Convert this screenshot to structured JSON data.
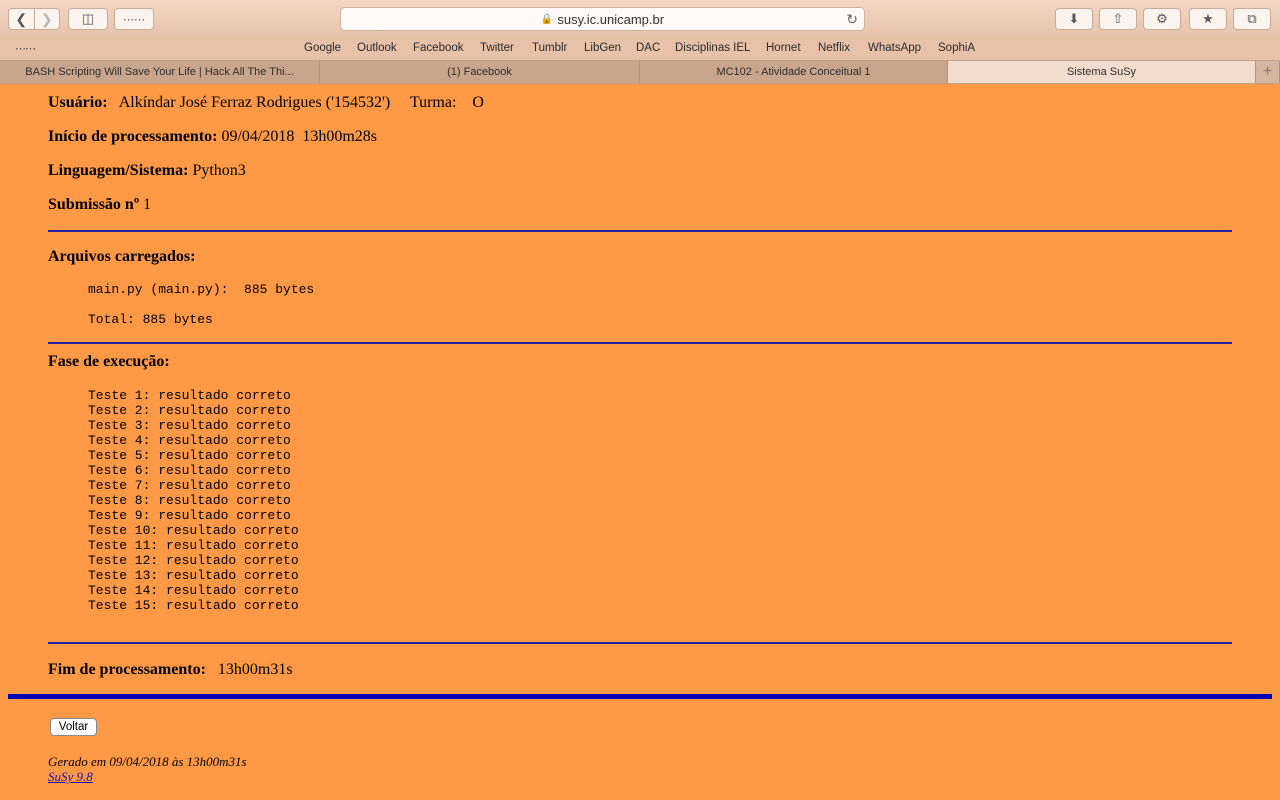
{
  "browser": {
    "url": "susy.ic.unicamp.br",
    "favorites": [
      "Google",
      "Outlook",
      "Facebook",
      "Twitter",
      "Tumblr",
      "LibGen",
      "DAC",
      "Disciplinas IEL",
      "Hornet",
      "Netflix",
      "WhatsApp",
      "SophiA"
    ],
    "tabs": [
      {
        "label": "BASH Scripting Will Save Your Life | Hack All The Thi...",
        "active": false
      },
      {
        "label": "(1) Facebook",
        "active": false
      },
      {
        "label": "MC102 - Atividade Conceitual 1",
        "active": false
      },
      {
        "label": "Sistema SuSy",
        "active": true
      }
    ],
    "new_tab_label": "+"
  },
  "report": {
    "user_label": "Usuário:",
    "user_value": "Alkíndar José Ferraz Rodrigues ('154532')",
    "class_label": "Turma:",
    "class_value": "O",
    "start_label": "Início de processamento:",
    "start_value": "09/04/2018  13h00m28s",
    "language_label": "Linguagem/Sistema:",
    "language_value": "Python3",
    "submission_label": "Submissão nº",
    "submission_value": "1",
    "files_heading": "Arquivos carregados:",
    "file_line": "main.py (main.py):  885 bytes",
    "total_line": "Total: 885 bytes",
    "execution_heading": "Fase de execução:",
    "tests": [
      "Teste 1: resultado correto",
      "Teste 2: resultado correto",
      "Teste 3: resultado correto",
      "Teste 4: resultado correto",
      "Teste 5: resultado correto",
      "Teste 6: resultado correto",
      "Teste 7: resultado correto",
      "Teste 8: resultado correto",
      "Teste 9: resultado correto",
      "Teste 10: resultado correto",
      "Teste 11: resultado correto",
      "Teste 12: resultado correto",
      "Teste 13: resultado correto",
      "Teste 14: resultado correto",
      "Teste 15: resultado correto"
    ],
    "end_label": "Fim de processamento:",
    "end_value": "13h00m31s",
    "back_button": "Voltar",
    "generated": "Gerado em 09/04/2018 às 13h00m31s",
    "version_link": "SuSy 9.8"
  },
  "colors": {
    "page_background": "#ff9946",
    "rule": "#1f1fa0",
    "thick_rule": "#0000b8",
    "link": "#1a0dab"
  }
}
